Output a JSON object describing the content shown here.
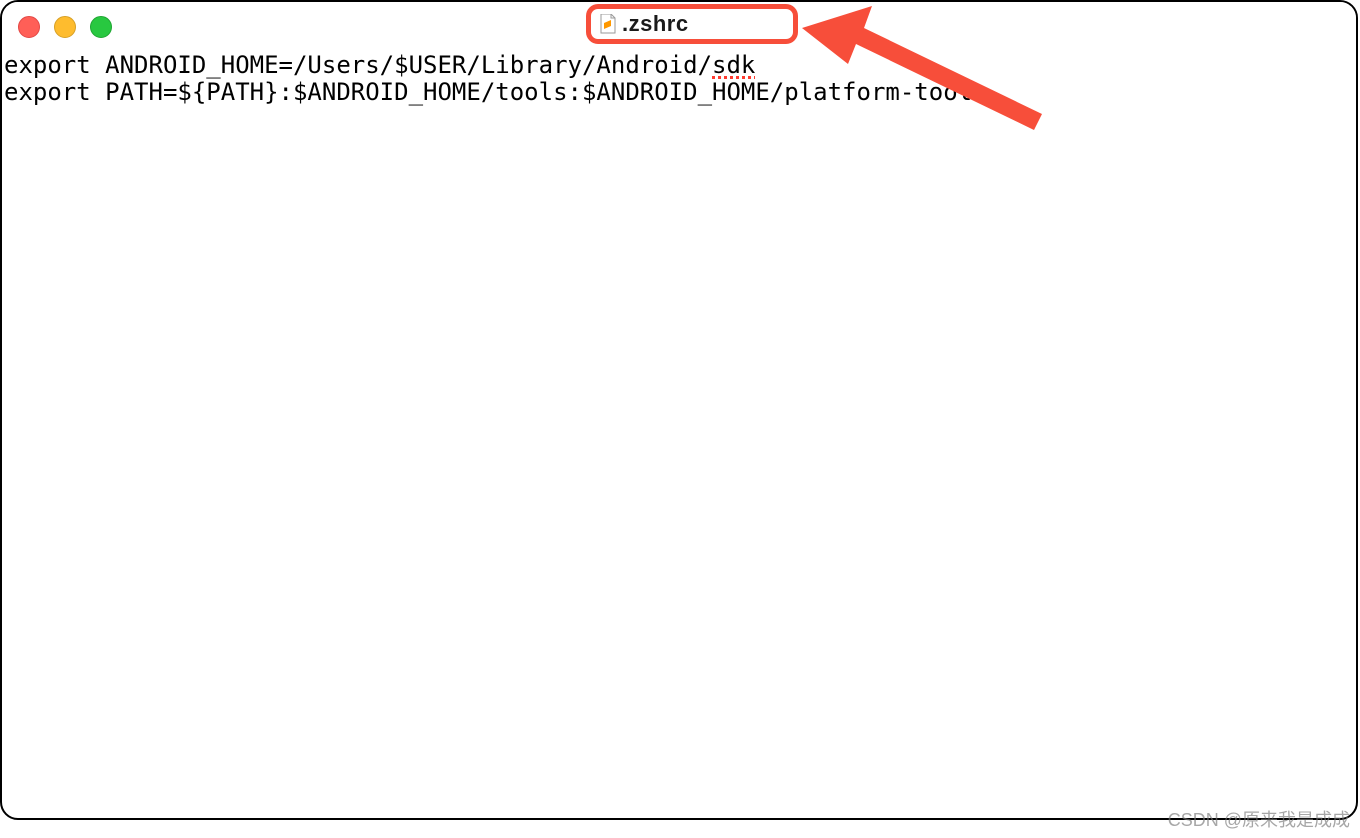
{
  "window": {
    "tab": {
      "icon": "sublime-file-icon",
      "filename": ".zshrc"
    }
  },
  "editor": {
    "lines": [
      "export ANDROID_HOME=/Users/$USER/Library/Android/sdk",
      "export PATH=${PATH}:$ANDROID_HOME/tools:$ANDROID_HOME/platform-tools"
    ],
    "line1_prefix": "export ANDROID_HOME=/Users/$USER/Library/Android/",
    "line1_underlined": "sdk",
    "line2": "export PATH=${PATH}:$ANDROID_HOME/tools:$ANDROID_HOME/platform-tools"
  },
  "annotation": {
    "highlight_color": "#f74e3a",
    "arrow_color": "#f74e3a"
  },
  "watermark": "CSDN @原来我是成成"
}
